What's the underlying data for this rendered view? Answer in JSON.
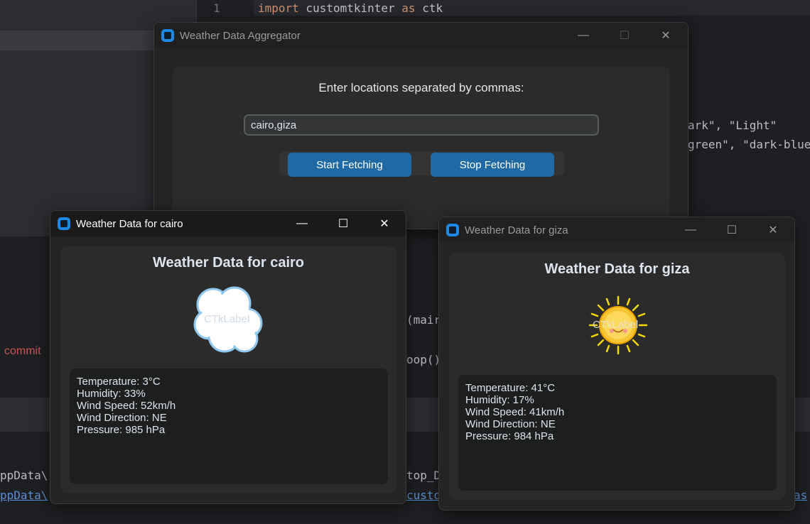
{
  "ide": {
    "line_number": "1",
    "code_line1": [
      "import",
      " customtkinter ",
      "as",
      " ctk"
    ],
    "code_frag_a": "ark\", \"Light\"",
    "code_frag_b": "green\", \"dark-blue",
    "code_frag_c": "(mair",
    "code_frag_d": "oop()",
    "commit_text": "commit",
    "term_line1_left": "ppData\\",
    "term_line1_right": "top_D",
    "term_line2_left": "ppData\\",
    "term_line2_right": "custo",
    "term_line2_end": "as"
  },
  "main_window": {
    "title": "Weather Data Aggregator",
    "prompt": "Enter locations separated by commas:",
    "location_value": "cairo,giza",
    "start_label": "Start Fetching",
    "stop_label": "Stop Fetching",
    "controls": {
      "minimize": "—",
      "maximize": "☐",
      "close": "✕"
    }
  },
  "cairo_window": {
    "title": "Weather Data for cairo",
    "heading": "Weather Data for cairo",
    "icon_label": "CTkLabel",
    "icon": "cloud-icon",
    "data": {
      "temperature": "Temperature: 3°C",
      "humidity": "Humidity: 33%",
      "wind_speed": "Wind Speed: 52km/h",
      "wind_direction": "Wind Direction: NE",
      "pressure": "Pressure: 985 hPa"
    },
    "controls": {
      "minimize": "—",
      "maximize": "☐",
      "close": "✕"
    }
  },
  "giza_window": {
    "title": "Weather Data for giza",
    "heading": "Weather Data for giza",
    "icon_label": "CTkLabel",
    "icon": "sun-icon",
    "data": {
      "temperature": "Temperature: 41°C",
      "humidity": "Humidity: 17%",
      "wind_speed": "Wind Speed: 41km/h",
      "wind_direction": "Wind Direction: NE",
      "pressure": "Pressure: 984 hPa"
    },
    "controls": {
      "minimize": "—",
      "maximize": "☐",
      "close": "✕"
    }
  },
  "colors": {
    "accent": "#1f6aa5",
    "window_bg": "#242424",
    "frame_bg": "#2b2b2b",
    "sun": "#f5c518",
    "cloud": "#ffffff"
  }
}
